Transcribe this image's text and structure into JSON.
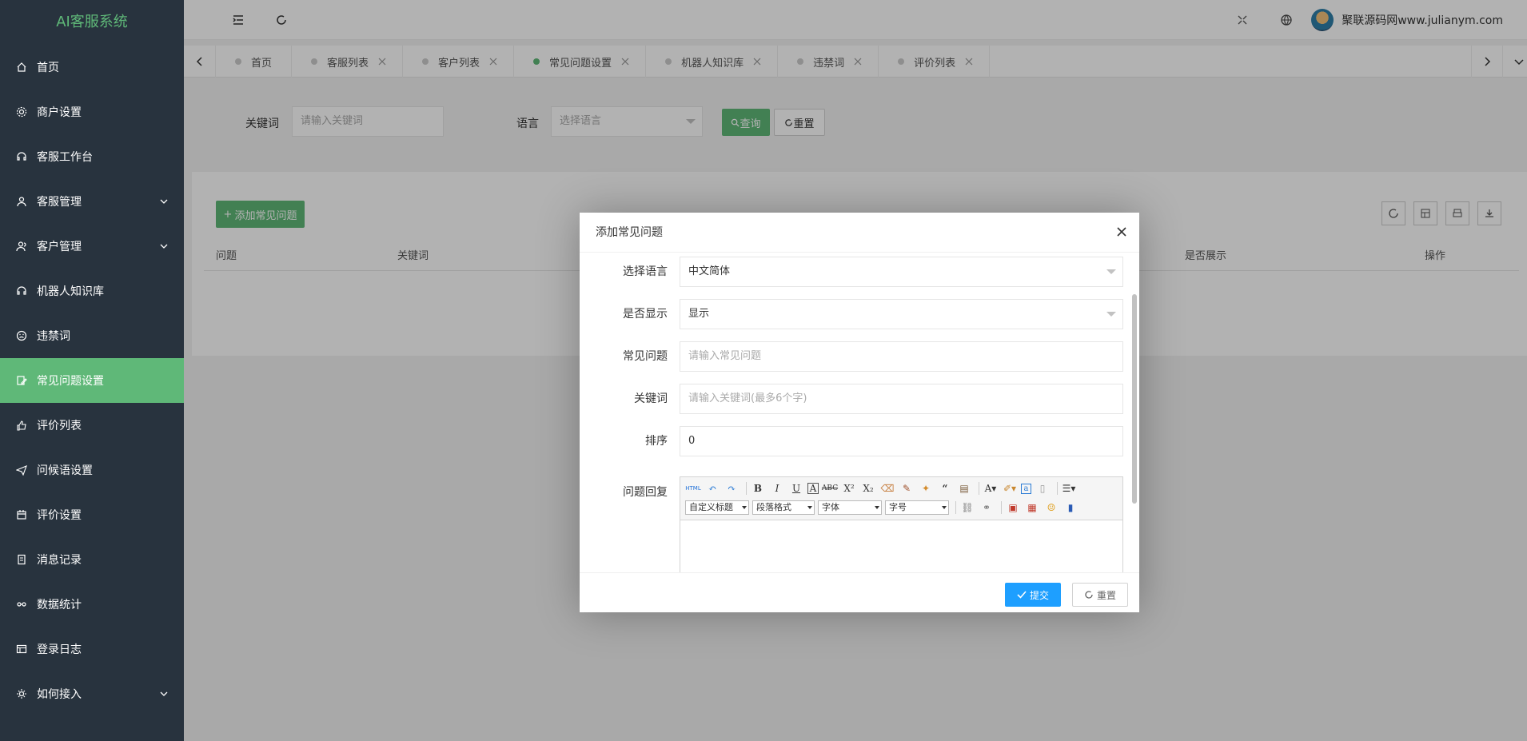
{
  "app": {
    "title": "AI客服系统"
  },
  "sidebar": {
    "items": [
      {
        "label": "首页",
        "icon": "home-icon"
      },
      {
        "label": "商户设置",
        "icon": "gear-icon"
      },
      {
        "label": "客服工作台",
        "icon": "headset-icon"
      },
      {
        "label": "客服管理",
        "icon": "user-icon",
        "expandable": true
      },
      {
        "label": "客户管理",
        "icon": "users-icon",
        "expandable": true
      },
      {
        "label": "机器人知识库",
        "icon": "robot-icon"
      },
      {
        "label": "违禁词",
        "icon": "face-icon"
      },
      {
        "label": "常见问题设置",
        "icon": "edit-icon",
        "active": true
      },
      {
        "label": "评价列表",
        "icon": "thumbs-up-icon"
      },
      {
        "label": "问候语设置",
        "icon": "send-icon"
      },
      {
        "label": "评价设置",
        "icon": "calendar-icon"
      },
      {
        "label": "消息记录",
        "icon": "document-icon"
      },
      {
        "label": "数据统计",
        "icon": "chart-icon"
      },
      {
        "label": "登录日志",
        "icon": "log-icon"
      },
      {
        "label": "如何接入",
        "icon": "plug-icon",
        "expandable": true
      }
    ]
  },
  "header": {
    "username": "聚联源码网www.julianym.com"
  },
  "tabs": [
    {
      "label": "首页",
      "closable": false
    },
    {
      "label": "客服列表",
      "closable": true
    },
    {
      "label": "客户列表",
      "closable": true
    },
    {
      "label": "常见问题设置",
      "closable": true,
      "active": true
    },
    {
      "label": "机器人知识库",
      "closable": true
    },
    {
      "label": "违禁词",
      "closable": true
    },
    {
      "label": "评价列表",
      "closable": true
    }
  ],
  "search": {
    "keyword_label": "关键词",
    "keyword_placeholder": "请输入关键词",
    "lang_label": "语言",
    "lang_placeholder": "选择语言",
    "query_label": "查询",
    "reset_label": "重置"
  },
  "table": {
    "add_label": "添加常见问题",
    "columns": [
      "问题",
      "关键词",
      "是否展示",
      "操作"
    ]
  },
  "modal": {
    "title": "添加常见问题",
    "fields": {
      "lang_label": "选择语言",
      "lang_value": "中文简体",
      "show_label": "是否显示",
      "show_value": "显示",
      "question_label": "常见问题",
      "question_placeholder": "请输入常见问题",
      "keyword_label": "关键词",
      "keyword_placeholder": "请输入关键词(最多6个字)",
      "sort_label": "排序",
      "sort_value": "0",
      "reply_label": "问题回复"
    },
    "editor": {
      "heading_select": "自定义标题",
      "paragraph_select": "段落格式",
      "font_select": "字体",
      "size_select": "字号"
    },
    "submit_label": "提交",
    "reset_label": "重置"
  },
  "colors": {
    "sidebar_bg": "#28333e",
    "accent_green": "#5fb878",
    "submit_blue": "#1e9fff"
  }
}
